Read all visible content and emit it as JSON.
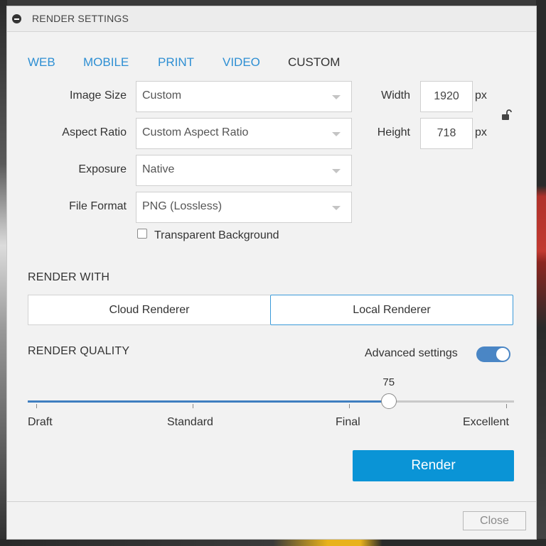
{
  "window": {
    "title": "RENDER SETTINGS",
    "collapse_icon": "collapse-icon"
  },
  "tabs": [
    {
      "label": "WEB",
      "active": false
    },
    {
      "label": "MOBILE",
      "active": false
    },
    {
      "label": "PRINT",
      "active": false
    },
    {
      "label": "VIDEO",
      "active": false
    },
    {
      "label": "CUSTOM",
      "active": true
    }
  ],
  "image_size": {
    "label": "Image Size",
    "value": "Custom"
  },
  "aspect_ratio": {
    "label": "Aspect Ratio",
    "value": "Custom Aspect Ratio"
  },
  "exposure": {
    "label": "Exposure",
    "value": "Native"
  },
  "file_format": {
    "label": "File Format",
    "value": "PNG (Lossless)"
  },
  "dimensions": {
    "width_label": "Width",
    "width_value": "1920",
    "height_label": "Height",
    "height_value": "718",
    "unit": "px",
    "lock_icon": "unlocked-lock-icon"
  },
  "transparent_background": {
    "label": "Transparent Background",
    "checked": false
  },
  "render_with": {
    "heading": "RENDER WITH",
    "options": [
      "Cloud Renderer",
      "Local Renderer"
    ],
    "selected": "Local Renderer"
  },
  "render_quality": {
    "heading": "RENDER QUALITY",
    "advanced_label": "Advanced settings",
    "advanced_enabled": true,
    "value": "75",
    "ticks": [
      "Draft",
      "Standard",
      "Final",
      "Excellent"
    ]
  },
  "buttons": {
    "render": "Render",
    "close": "Close"
  },
  "colors": {
    "accent": "#2e8fd3",
    "render_button": "#0a94d6",
    "toggle_on": "#4a86c5",
    "slider_fill": "#3f7fc0"
  }
}
